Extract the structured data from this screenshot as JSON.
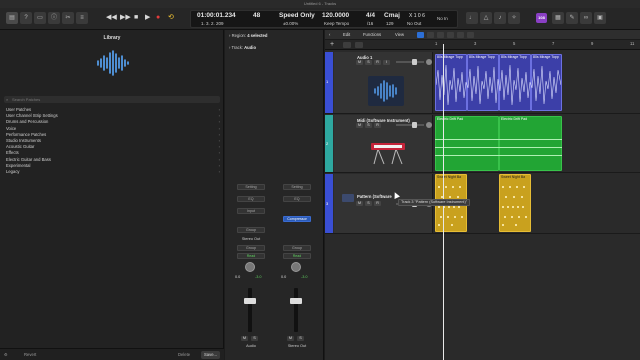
{
  "window": {
    "title": "Untitled 6 - Tracks"
  },
  "transport": {
    "rewind": "◀◀",
    "forward": "▶▶",
    "stop": "■",
    "play": "▶",
    "record": "●",
    "cycle": "⟲"
  },
  "lcd": {
    "time": "01:00:01.234",
    "bars": "1. 3. 2. 209",
    "beat_top": "48",
    "mode_top": "Speed Only",
    "mode_bottom": "±0.00%",
    "tempo": "120.0000",
    "tempo_sub": "Keep Tempo",
    "sig": "4/4",
    "sig_sub": "/16",
    "key": "Cmaj",
    "key_sub": "129",
    "io": "X 1 0 6",
    "in_label": "No In",
    "out_label": "No Out"
  },
  "badge": "108",
  "library": {
    "title": "Library",
    "search_placeholder": "Search Patches",
    "items": [
      "User Patches",
      "User Channel Strip Settings",
      "Drums and Percussion",
      "Voice",
      "Performance Patches",
      "Studio Instruments",
      "Acoustic Guitar",
      "Effects",
      "Electric Guitar and Bass",
      "Experimental",
      "Legacy"
    ],
    "footer_revert": "Revert",
    "footer_delete": "Delete",
    "footer_save": "Save..."
  },
  "inspector": {
    "region_label": "Region:",
    "region_value": "4 selected",
    "track_label": "Track:",
    "track_value": "Audio",
    "strip1": {
      "setting": "Setting",
      "eq": "EQ",
      "input": "Input",
      "group": "Group",
      "read": "Read",
      "out": "Stereo Out",
      "peak": "-3.0",
      "vol": "0.0",
      "name": "Audio",
      "m": "M",
      "s": "S"
    },
    "strip2": {
      "setting": "Setting",
      "eq": "EQ",
      "plugin": "Compressor",
      "group": "Group",
      "read": "Read",
      "peak": "-3.0",
      "vol": "0.0",
      "name": "Stereo Out",
      "m": "M",
      "s": "S"
    }
  },
  "tracks_toolbar": {
    "edit": "Edit",
    "functions": "Functions",
    "view": "View"
  },
  "ruler": [
    "1",
    "3",
    "5",
    "7",
    "9",
    "11"
  ],
  "tracks": [
    {
      "number": "1",
      "name": "Audio 1",
      "color": "#3a4fd4",
      "regions": [
        "80s Mirage Topp",
        "80s Mirage Topp",
        "80s Mirage Topp",
        "80s Mirage Topp"
      ]
    },
    {
      "number": "2",
      "name": "Midi (Software Instrument)",
      "color": "#2ea8a0",
      "regions": [
        "Electric Drift Pad",
        "Electric Drift Pad"
      ]
    },
    {
      "number": "3",
      "name": "Pattern (Software",
      "color": "#3a4fd4",
      "regions": [
        "Sweet Night Ba",
        "Sweet Night Ba"
      ]
    }
  ],
  "tooltip": "Track 3 \"Pattern (Software Instrument)\"",
  "colors": {
    "audio_region": "#3c3fa8",
    "midi_region": "#22a534",
    "pattern_region": "#c9a11e",
    "record": "#e23b3b",
    "cycle": "#f0c233",
    "badge": "#8a3fc4"
  }
}
